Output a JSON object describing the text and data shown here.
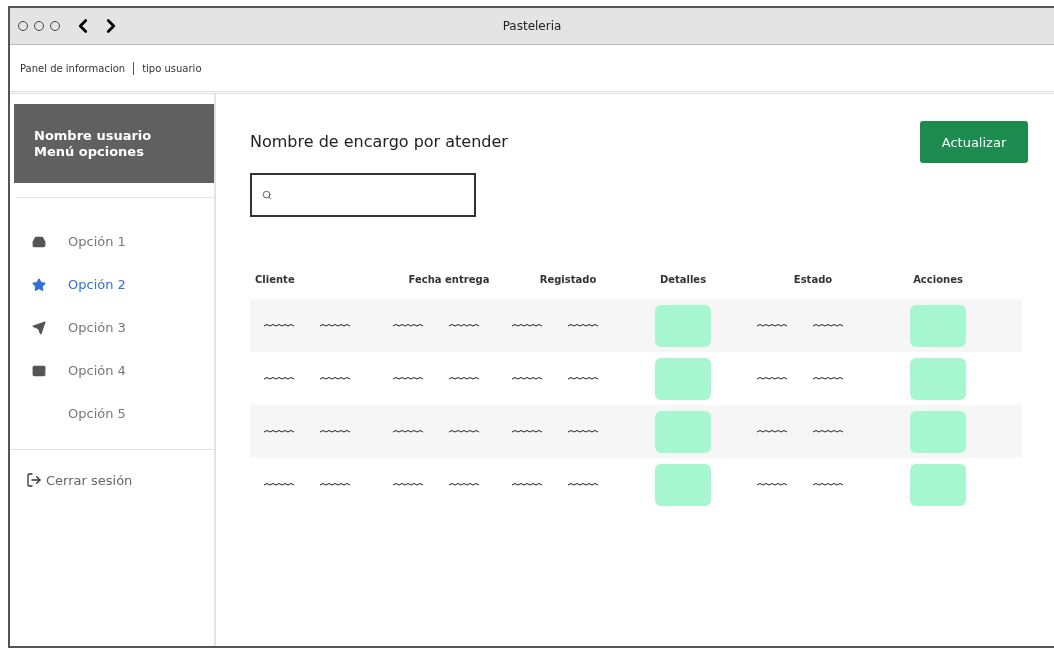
{
  "window": {
    "title": "Pasteleria"
  },
  "breadcrumb": [
    "Panel de informacion",
    "tipo usuario"
  ],
  "sidebar": {
    "header": [
      "Nombre usuario",
      "Menú opciones"
    ],
    "items": [
      {
        "label": "Opción 1",
        "selected": false
      },
      {
        "label": "Opción 2",
        "selected": true
      },
      {
        "label": "Opción 3",
        "selected": false
      },
      {
        "label": "Opción 4",
        "selected": false
      },
      {
        "label": "Opción 5",
        "selected": false
      }
    ],
    "logout": "Cerrar sesión"
  },
  "main": {
    "title": "Nombre de encargo por atender",
    "refresh_button": "Actualizar",
    "table": {
      "columns": [
        {
          "label": "Cliente",
          "kind": "scribble"
        },
        {
          "label": "Fecha entrega",
          "kind": "scribble"
        },
        {
          "label": "Registado",
          "kind": "scribble"
        },
        {
          "label": "Detalles",
          "kind": "box"
        },
        {
          "label": "Estado",
          "kind": "scribble"
        },
        {
          "label": "Acciones",
          "kind": "box"
        }
      ],
      "rows": [
        {
          "kind": "placeholder"
        },
        {
          "kind": "placeholder"
        },
        {
          "kind": "placeholder"
        },
        {
          "kind": "placeholder"
        }
      ]
    }
  }
}
